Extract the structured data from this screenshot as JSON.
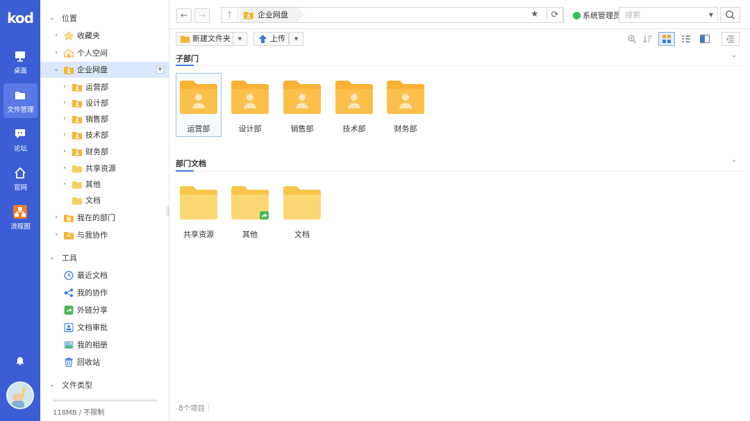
{
  "brand": {
    "logo_text": "kod",
    "rail_color": "#3b5ed6"
  },
  "rail": {
    "items": [
      {
        "label": "桌面",
        "icon": "monitor-icon"
      },
      {
        "label": "文件管理",
        "icon": "folder-icon",
        "active": true
      },
      {
        "label": "论坛",
        "icon": "chat-bubble-icon"
      },
      {
        "label": "官网",
        "icon": "home-icon"
      },
      {
        "label": "流程图",
        "icon": "flowchart-icon"
      }
    ],
    "bell_icon": "bell-icon",
    "avatar_icon": "user-avatar-icon"
  },
  "tree": {
    "location_label": "位置",
    "location_items": [
      {
        "label": "收藏夹",
        "icon": "star-icon"
      },
      {
        "label": "个人空间",
        "icon": "home-folder-icon"
      },
      {
        "label": "企业网盘",
        "icon": "enterprise-folder-icon",
        "selected": true
      }
    ],
    "enterprise_children": [
      {
        "label": "运营部",
        "icon": "dept-folder-icon"
      },
      {
        "label": "设计部",
        "icon": "dept-folder-icon"
      },
      {
        "label": "销售部",
        "icon": "dept-folder-icon"
      },
      {
        "label": "技术部",
        "icon": "dept-folder-icon"
      },
      {
        "label": "财务部",
        "icon": "dept-folder-icon"
      },
      {
        "label": "共享资源",
        "icon": "folder-icon"
      },
      {
        "label": "其他",
        "icon": "folder-icon"
      },
      {
        "label": "文档",
        "icon": "folder-icon"
      }
    ],
    "extra_items": [
      {
        "label": "我在的部门",
        "icon": "department-icon"
      },
      {
        "label": "与我协作",
        "icon": "collaborate-folder-icon"
      }
    ],
    "tools_label": "工具",
    "tools": [
      {
        "label": "最近文档",
        "icon": "clock-icon"
      },
      {
        "label": "我的协作",
        "icon": "share-nodes-icon"
      },
      {
        "label": "外链分享",
        "icon": "external-share-icon"
      },
      {
        "label": "文档审批",
        "icon": "approval-icon"
      },
      {
        "label": "我的相册",
        "icon": "photo-icon"
      },
      {
        "label": "回收站",
        "icon": "trash-icon"
      }
    ],
    "file_types_label": "文件类型",
    "storage_text": "118MB / 不限制",
    "storage_used_fraction": 0.0
  },
  "topbar": {
    "back_symbol": "←",
    "forward_symbol": "→",
    "up_symbol": "↑",
    "breadcrumb": "企业网盘",
    "star_symbol": "★",
    "refresh_symbol": "⟳",
    "user_name": "系统管理员",
    "search_placeholder": "搜索",
    "search_caret": "▼"
  },
  "toolbar": {
    "new_folder_label": "新建文件夹",
    "upload_label": "上传",
    "caret": "▼"
  },
  "content": {
    "groups": [
      {
        "title": "子部门",
        "items": [
          {
            "label": "运营部",
            "icon": "dept-folder-icon",
            "selected": true
          },
          {
            "label": "设计部",
            "icon": "dept-folder-icon"
          },
          {
            "label": "销售部",
            "icon": "dept-folder-icon"
          },
          {
            "label": "技术部",
            "icon": "dept-folder-icon"
          },
          {
            "label": "财务部",
            "icon": "dept-folder-icon"
          }
        ]
      },
      {
        "title": "部门文档",
        "items": [
          {
            "label": "共享资源",
            "icon": "folder-icon"
          },
          {
            "label": "其他",
            "icon": "shared-folder-icon"
          },
          {
            "label": "文档",
            "icon": "folder-icon"
          }
        ]
      }
    ],
    "collapse_symbol": "⌄",
    "item_count": "8个项目"
  },
  "colors": {
    "folder_yellow": "#f9cf5f",
    "dept_folder_orange": "#f9b233",
    "accent_blue": "#3b7ddd",
    "status_green": "#2fbf5e"
  }
}
